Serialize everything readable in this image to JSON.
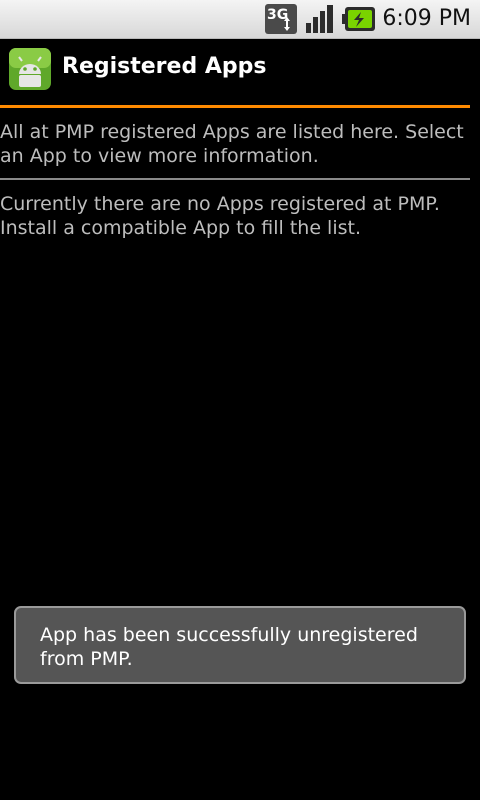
{
  "status_bar": {
    "network_label": "3G",
    "time": "6:09 PM",
    "icons": [
      "3g-icon",
      "signal-icon",
      "battery-charging-icon"
    ]
  },
  "title_bar": {
    "title": "Registered Apps",
    "icon": "android-app-icon"
  },
  "content": {
    "intro": "All at PMP registered Apps are listed here. Select an App to view more information.",
    "empty_message": "Currently there are no Apps registered at PMP. Install a compatible App to fill the list."
  },
  "toast": {
    "message": "App has been successfully unregistered from PMP."
  },
  "colors": {
    "accent": "#ff8a00",
    "background": "#000000",
    "toast_bg": "#555555",
    "text": "#bdbdbd"
  }
}
